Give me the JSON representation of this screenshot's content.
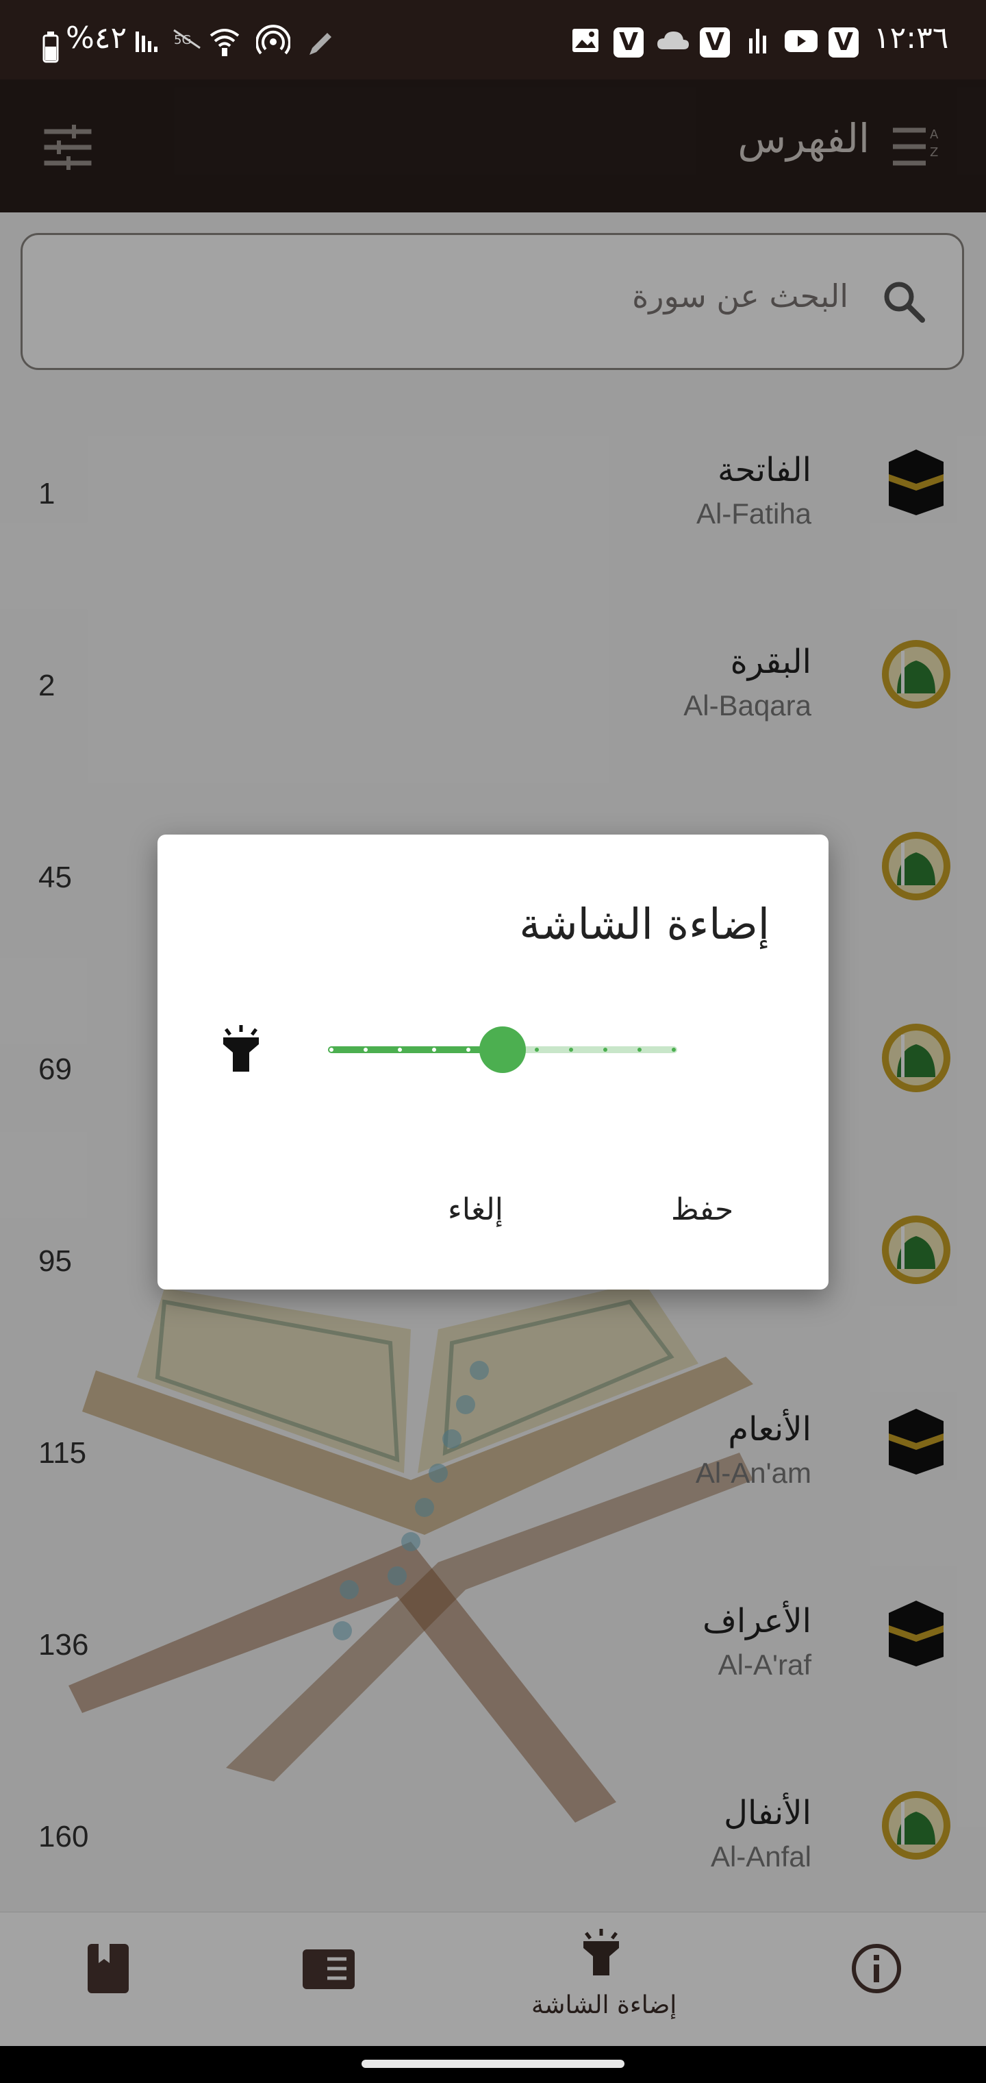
{
  "status_bar": {
    "battery": "%٤٢",
    "time": "١٢:٣٦",
    "left_icons": [
      "battery-icon",
      "signal-icon",
      "no-data-icon",
      "wifi-icon",
      "hotspot-icon",
      "pen-icon"
    ],
    "right_icons": [
      "image-icon",
      "v-app-icon",
      "cloud-icon",
      "v-app-icon",
      "signal-bars-icon",
      "youtube-icon",
      "v-app-icon"
    ],
    "v_letter": "V"
  },
  "app_bar": {
    "title": "الفهرس",
    "menu_icon": "sort-list-icon",
    "settings_icon": "tune-sliders-icon"
  },
  "search": {
    "placeholder": "البحث عن سورة",
    "icon": "search-icon"
  },
  "surahs": [
    {
      "ar": "الفاتحة",
      "en": "Al-Fatiha",
      "page": "1",
      "type": "kaaba"
    },
    {
      "ar": "البقرة",
      "en": "Al-Baqara",
      "page": "2",
      "type": "mosque"
    },
    {
      "ar": "",
      "en": "",
      "page": "45",
      "type": "mosque"
    },
    {
      "ar": "",
      "en": "",
      "page": "69",
      "type": "mosque"
    },
    {
      "ar": "",
      "en": "",
      "page": "95",
      "type": "mosque"
    },
    {
      "ar": "الأنعام",
      "en": "Al-An'am",
      "page": "115",
      "type": "kaaba"
    },
    {
      "ar": "الأعراف",
      "en": "Al-A'raf",
      "page": "136",
      "type": "kaaba"
    },
    {
      "ar": "الأنفال",
      "en": "Al-Anfal",
      "page": "160",
      "type": "mosque"
    }
  ],
  "dialog": {
    "title": "إضاءة الشاشة",
    "slider_icon": "flashlight-icon",
    "brightness_level": 0.5,
    "slider_steps": 10,
    "save_label": "حفظ",
    "cancel_label": "إلغاء",
    "accent_color": "#4caf50"
  },
  "bottom_nav": {
    "items": [
      {
        "icon": "bookmark-book-icon",
        "label": ""
      },
      {
        "icon": "index-book-icon",
        "label": ""
      },
      {
        "icon": "flashlight-icon",
        "label": "إضاءة الشاشة"
      },
      {
        "icon": "info-icon",
        "label": ""
      }
    ]
  },
  "colors": {
    "app_bar": "#2a1f1c",
    "status_bar": "#231815",
    "accent": "#4caf50",
    "nav_icon": "#4a3631"
  }
}
